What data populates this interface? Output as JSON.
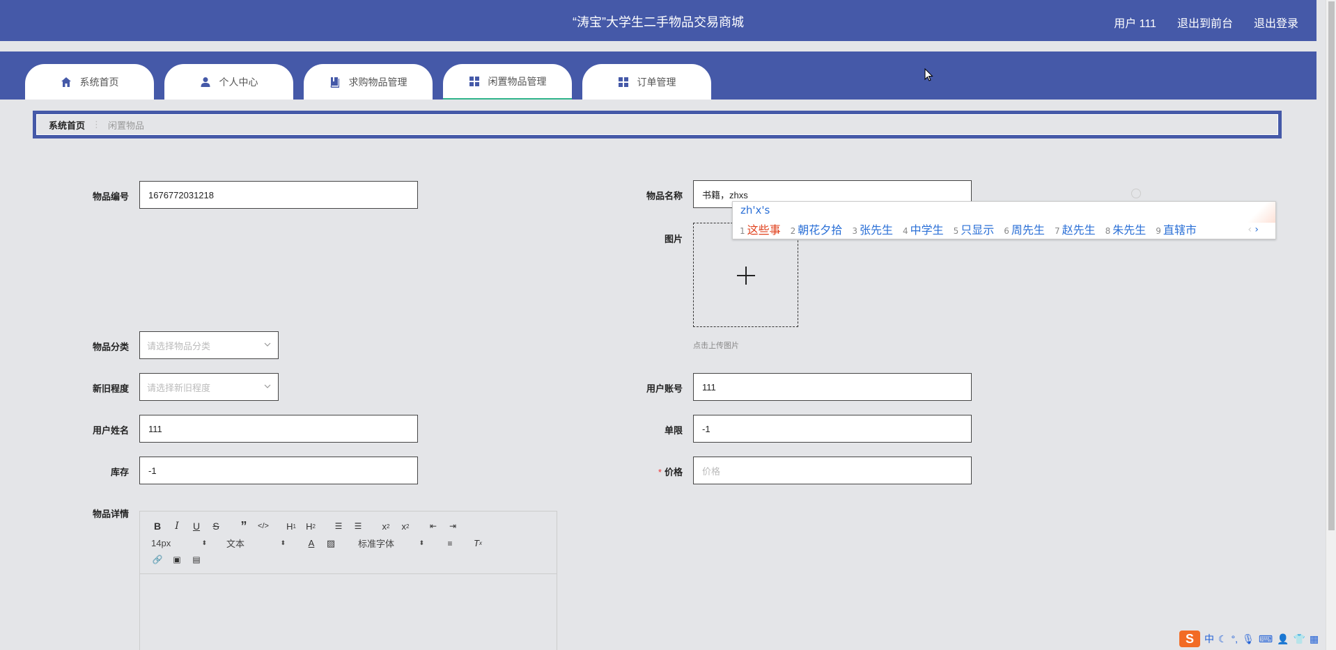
{
  "header": {
    "title": "“涛宝”大学生二手物品交易商城",
    "user": "用户 111",
    "back_front": "退出到前台",
    "logout": "退出登录"
  },
  "tabs": [
    {
      "label": "系统首页",
      "icon": "home-icon"
    },
    {
      "label": "个人中心",
      "icon": "user-icon"
    },
    {
      "label": "求购物品管理",
      "icon": "book-icon"
    },
    {
      "label": "闲置物品管理",
      "icon": "grid-icon",
      "active": true
    },
    {
      "label": "订单管理",
      "icon": "grid-icon"
    }
  ],
  "breadcrumb": {
    "home": "系统首页",
    "current": "闲置物品"
  },
  "form": {
    "item_no_label": "物品编号",
    "item_no_value": "1676772031218",
    "item_name_label": "物品名称",
    "item_name_value": "书籍，zhxs",
    "image_label": "图片",
    "upload_hint": "点击上传图片",
    "category_label": "物品分类",
    "category_placeholder": "请选择物品分类",
    "condition_label": "新旧程度",
    "condition_placeholder": "请选择新旧程度",
    "account_label": "用户账号",
    "account_value": "111",
    "username_label": "用户姓名",
    "username_value": "111",
    "limit_label": "单限",
    "limit_value": "-1",
    "stock_label": "库存",
    "stock_value": "-1",
    "price_label": "价格",
    "price_placeholder": "价格",
    "detail_label": "物品详情"
  },
  "editor": {
    "font_size": "14px",
    "block_type": "文本",
    "font_family": "标准字体"
  },
  "ime": {
    "composition": "zh'x's",
    "candidates": [
      {
        "num": "1",
        "text": "这些事"
      },
      {
        "num": "2",
        "text": "朝花夕拾"
      },
      {
        "num": "3",
        "text": "张先生"
      },
      {
        "num": "4",
        "text": "中学生"
      },
      {
        "num": "5",
        "text": "只显示"
      },
      {
        "num": "6",
        "text": "周先生"
      },
      {
        "num": "7",
        "text": "赵先生"
      },
      {
        "num": "8",
        "text": "朱先生"
      },
      {
        "num": "9",
        "text": "直辖市"
      }
    ],
    "tray_lang": "中"
  }
}
